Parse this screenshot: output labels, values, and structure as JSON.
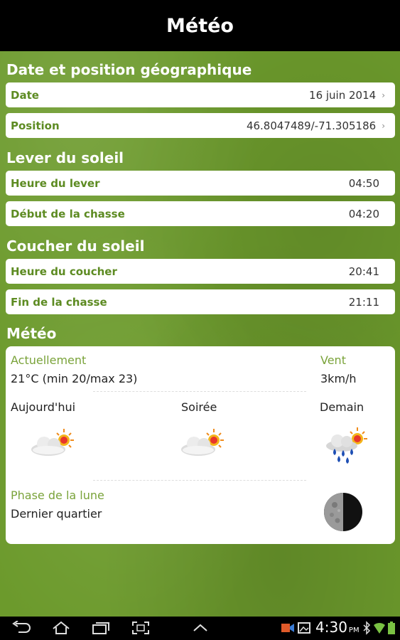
{
  "app": {
    "title": "Météo"
  },
  "sections": {
    "position": "Date et position géographique",
    "sunrise": "Lever du soleil",
    "sunset": "Coucher du soleil",
    "weather": "Météo"
  },
  "rows": {
    "date": {
      "label": "Date",
      "value": "16 juin 2014"
    },
    "position": {
      "label": "Position",
      "value": "46.8047489/-71.305186"
    },
    "sunrise_time": {
      "label": "Heure du lever",
      "value": "04:50"
    },
    "hunt_start": {
      "label": "Début de la chasse",
      "value": "04:20"
    },
    "sunset_time": {
      "label": "Heure du coucher",
      "value": "20:41"
    },
    "hunt_end": {
      "label": "Fin de la chasse",
      "value": "21:11"
    }
  },
  "weather": {
    "current_label": "Actuellement",
    "current_value": "21°C (min 20/max 23)",
    "wind_label": "Vent",
    "wind_value": "3km/h",
    "today_label": "Aujourd'hui",
    "today_icon": "partly-cloudy-icon",
    "evening_label": "Soirée",
    "evening_icon": "partly-cloudy-icon",
    "tomorrow_label": "Demain",
    "tomorrow_icon": "rain-sun-icon",
    "moon_label": "Phase de la lune",
    "moon_value": "Dernier quartier",
    "moon_icon": "moon-last-quarter-icon"
  },
  "statusbar": {
    "time": "4:30",
    "ampm": "PM"
  },
  "colors": {
    "background_green": "#6c9a2c",
    "label_green": "#5d8b22",
    "light_green": "#7aa33a"
  }
}
